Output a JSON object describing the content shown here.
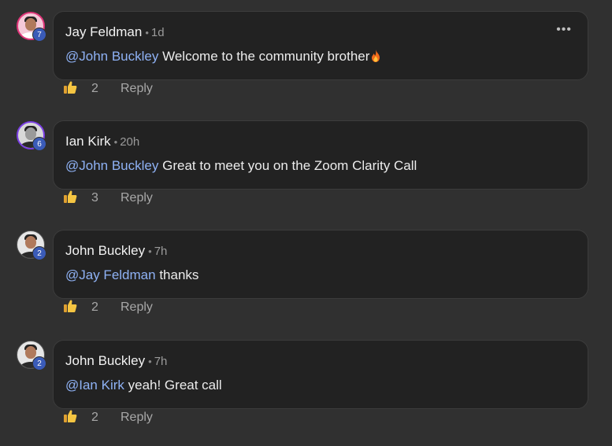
{
  "comments": [
    {
      "author": "Jay Feldman",
      "time": "1d",
      "badge": "7",
      "mention": "@John Buckley",
      "text": "Welcome to the community brother",
      "likes": "2",
      "reply": "Reply",
      "more": "•••"
    },
    {
      "author": "Ian Kirk",
      "time": "20h",
      "badge": "6",
      "mention": "@John Buckley",
      "text": "Great to meet you on the Zoom Clarity Call",
      "likes": "3",
      "reply": "Reply"
    },
    {
      "author": "John Buckley",
      "time": "7h",
      "badge": "2",
      "mention": "@Jay Feldman",
      "text": "thanks",
      "likes": "2",
      "reply": "Reply"
    },
    {
      "author": "John Buckley",
      "time": "7h",
      "badge": "2",
      "mention": "@Ian Kirk",
      "text": "yeah! Great call",
      "likes": "2",
      "reply": "Reply"
    }
  ],
  "separator": "•",
  "colors": {
    "mention": "#8fb2f5",
    "badge": "#3a5bb8",
    "background": "#303030",
    "bubble": "#222222"
  },
  "icons": {
    "like": "thumbs-up-icon",
    "more": "more-horizontal-icon",
    "emoji": "fire-emoji-icon"
  }
}
